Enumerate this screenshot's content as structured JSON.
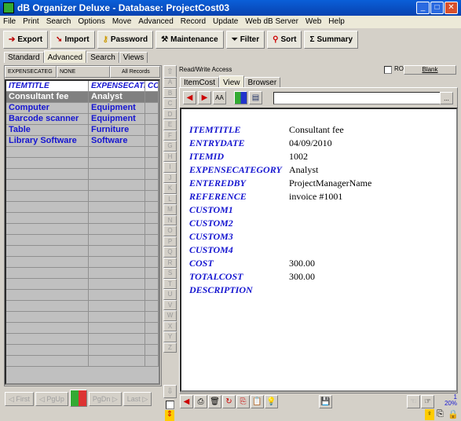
{
  "window": {
    "title": "dB Organizer Deluxe - Database: ProjectCost03"
  },
  "menu": [
    "File",
    "Print",
    "Search",
    "Options",
    "Move",
    "Advanced",
    "Record",
    "Update",
    "Web dB Server",
    "Web",
    "Help"
  ],
  "toolbar": [
    {
      "label": "Export",
      "icon": "export-icon"
    },
    {
      "label": "Import",
      "icon": "import-icon"
    },
    {
      "label": "Password",
      "icon": "key-icon"
    },
    {
      "label": "Maintenance",
      "icon": "tools-icon"
    },
    {
      "label": "Filter",
      "icon": "filter-icon"
    },
    {
      "label": "Sort",
      "icon": "sort-icon"
    },
    {
      "label": "Summary",
      "icon": "sigma-icon"
    }
  ],
  "mode_tabs": [
    "Standard",
    "Advanced",
    "Search",
    "Views"
  ],
  "mode_tab_selected": "Advanced",
  "left": {
    "filters": [
      "EXPENSECATEG",
      "NONE",
      "All Records"
    ],
    "columns": [
      "ITEMTITLE",
      "EXPENSECATEG",
      "COS"
    ],
    "rows": [
      [
        "Consultant fee",
        "Analyst"
      ],
      [
        "Computer",
        "Equipment"
      ],
      [
        "Barcode scanner",
        "Equipment"
      ],
      [
        "Table",
        "Furniture"
      ],
      [
        "Library Software",
        "Software"
      ]
    ],
    "selected_row": 0,
    "nav": [
      "First",
      "PgUp",
      "PgDn",
      "Last"
    ]
  },
  "letters": [
    "A",
    "B",
    "C",
    "D",
    "E",
    "F",
    "G",
    "H",
    "I",
    "J",
    "K",
    "L",
    "M",
    "N",
    "O",
    "P",
    "Q",
    "R",
    "S",
    "T",
    "U",
    "V",
    "W",
    "X",
    "Y",
    "Z"
  ],
  "right": {
    "access": "Read/Write Access",
    "ro_label": "RO",
    "blank_label": "Blank",
    "tabs": [
      "ItemCost",
      "View",
      "Browser"
    ],
    "tab_selected": "View",
    "fields": [
      {
        "label": "ITEMTITLE",
        "value": "Consultant fee"
      },
      {
        "label": "ENTRYDATE",
        "value": "04/09/2010"
      },
      {
        "label": "ITEMID",
        "value": "1002"
      },
      {
        "label": "EXPENSECATEGORY",
        "value": "Analyst"
      },
      {
        "label": "ENTEREDBY",
        "value": "ProjectManagerName"
      },
      {
        "label": "REFERENCE",
        "value": "invoice #1001"
      },
      {
        "label": "CUSTOM1",
        "value": ""
      },
      {
        "label": "CUSTOM2",
        "value": ""
      },
      {
        "label": "CUSTOM3",
        "value": ""
      },
      {
        "label": "CUSTOM4",
        "value": ""
      },
      {
        "label": "COST",
        "value": "300.00"
      },
      {
        "label": "TOTALCOST",
        "value": "300.00"
      },
      {
        "label": "DESCRIPTION",
        "value": ""
      }
    ]
  },
  "status": {
    "record": "1",
    "zoom": "20%"
  }
}
